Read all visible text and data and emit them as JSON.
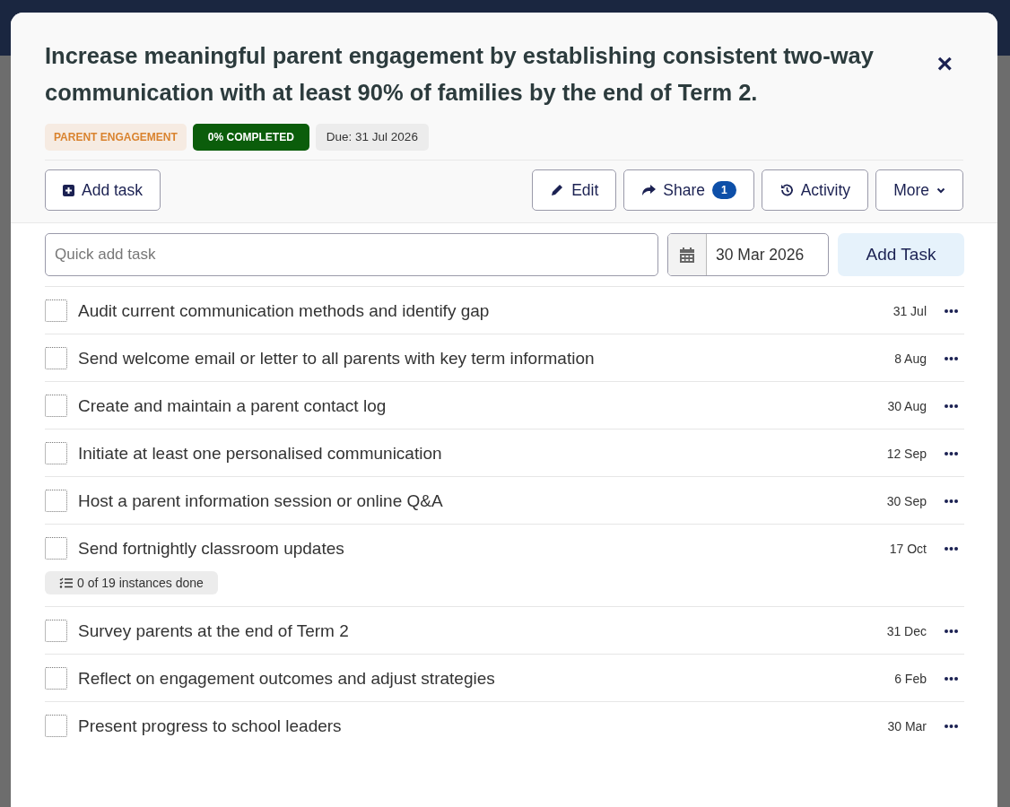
{
  "goal": {
    "title": "Increase meaningful parent engagement by establishing consistent two-way communication with at least 90% of families by the end of Term 2.",
    "close": "×",
    "tags": [
      {
        "kind": "category",
        "label": "PARENT ENGAGEMENT"
      },
      {
        "kind": "progress",
        "label": "0% COMPLETED"
      },
      {
        "kind": "due",
        "label": "Due: 31 Jul 2026"
      }
    ]
  },
  "toolbar": {
    "add_task": "Add task",
    "actions": [
      {
        "kind": "edit",
        "label": "Edit"
      },
      {
        "kind": "share",
        "label": "Share",
        "count": "1"
      },
      {
        "kind": "activity",
        "label": "Activity"
      },
      {
        "kind": "more",
        "label": "More"
      }
    ]
  },
  "quick_add": {
    "placeholder": "Quick add task",
    "date": "30 Mar 2026",
    "button": "Add Task"
  },
  "tasks": [
    {
      "title": "Audit current communication methods and identify gap",
      "due": "31 Jul",
      "checked": false
    },
    {
      "title": "Send welcome email or letter to all parents with key term information",
      "due": "8 Aug",
      "checked": false
    },
    {
      "title": "Create and maintain a parent contact log",
      "due": "30 Aug",
      "checked": false
    },
    {
      "title": "Initiate at least one personalised communication",
      "due": "12 Sep",
      "checked": false
    },
    {
      "title": "Host a parent information session or online Q&A",
      "due": "30 Sep",
      "checked": false
    },
    {
      "title": "Send fortnightly classroom updates",
      "due": "17 Oct",
      "checked": false,
      "instances": "0 of 19 instances done"
    },
    {
      "title": "Survey parents at the end of Term 2",
      "due": "31 Dec",
      "checked": false
    },
    {
      "title": "Reflect on engagement outcomes and adjust strategies",
      "due": "6 Feb",
      "checked": false
    },
    {
      "title": "Present progress to school leaders",
      "due": "30 Mar",
      "checked": false
    }
  ]
}
